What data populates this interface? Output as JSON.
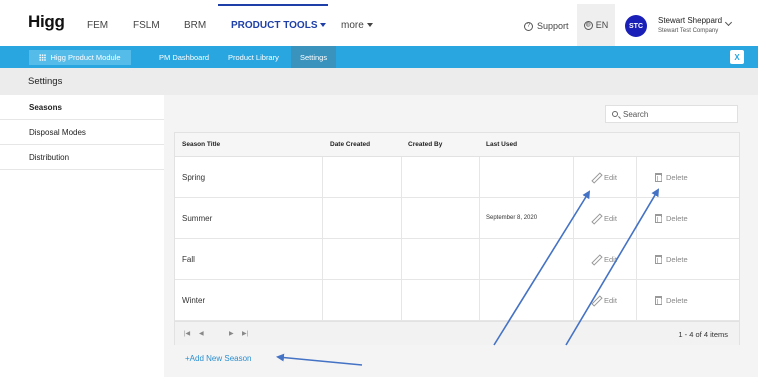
{
  "header": {
    "logo": "Higg",
    "nav": [
      {
        "label": "FEM"
      },
      {
        "label": "FSLM"
      },
      {
        "label": "BRM"
      },
      {
        "label": "PRODUCT TOOLS"
      },
      {
        "label": "more"
      }
    ],
    "support": "Support",
    "language": "EN",
    "user": {
      "initials": "STC",
      "name": "Stewart Sheppard",
      "company": "Stewart Test Company"
    }
  },
  "module_bar": {
    "module_label": "Higg Product Module",
    "tabs": [
      {
        "label": "PM Dashboard"
      },
      {
        "label": "Product Library"
      },
      {
        "label": "Settings"
      }
    ]
  },
  "page": {
    "title": "Settings"
  },
  "sidebar": {
    "items": [
      {
        "label": "Seasons"
      },
      {
        "label": "Disposal Modes"
      },
      {
        "label": "Distribution"
      }
    ]
  },
  "search": {
    "placeholder": "Search"
  },
  "table": {
    "columns": [
      "Season Title",
      "Date Created",
      "Created By",
      "Last Used"
    ],
    "rows": [
      {
        "title": "Spring",
        "date_created": "",
        "created_by": "",
        "last_used": ""
      },
      {
        "title": "Summer",
        "date_created": "",
        "created_by": "",
        "last_used": "September 8, 2020"
      },
      {
        "title": "Fall",
        "date_created": "",
        "created_by": "",
        "last_used": ""
      },
      {
        "title": "Winter",
        "date_created": "",
        "created_by": "",
        "last_used": ""
      }
    ],
    "edit_label": "Edit",
    "delete_label": "Delete",
    "pager_info": "1 - 4 of 4 items"
  },
  "add_season_label": "+Add New Season",
  "colors": {
    "accent": "#29a6df",
    "nav_active": "#1e3fa8",
    "annotation_arrow": "#4472c4"
  }
}
